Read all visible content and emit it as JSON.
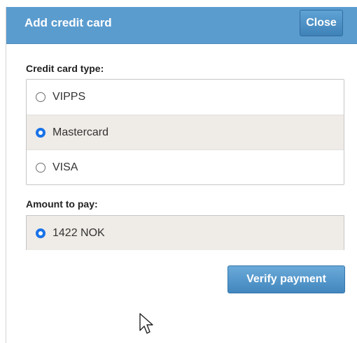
{
  "dialog": {
    "title": "Add credit card",
    "close_label": "Close"
  },
  "card_type": {
    "label": "Credit card type:",
    "options": [
      {
        "label": "VIPPS",
        "selected": false
      },
      {
        "label": "Mastercard",
        "selected": true
      },
      {
        "label": "VISA",
        "selected": false
      }
    ]
  },
  "amount": {
    "label": "Amount to pay:",
    "options": [
      {
        "label": "1422 NOK",
        "selected": true
      }
    ]
  },
  "actions": {
    "verify_label": "Verify payment"
  },
  "colors": {
    "header": "#5b9ccf",
    "button": "#4186bd",
    "selected_row": "#efebe6",
    "radio_checked": "#1a73e8"
  },
  "icons": {
    "cursor": "mouse-pointer-icon"
  }
}
